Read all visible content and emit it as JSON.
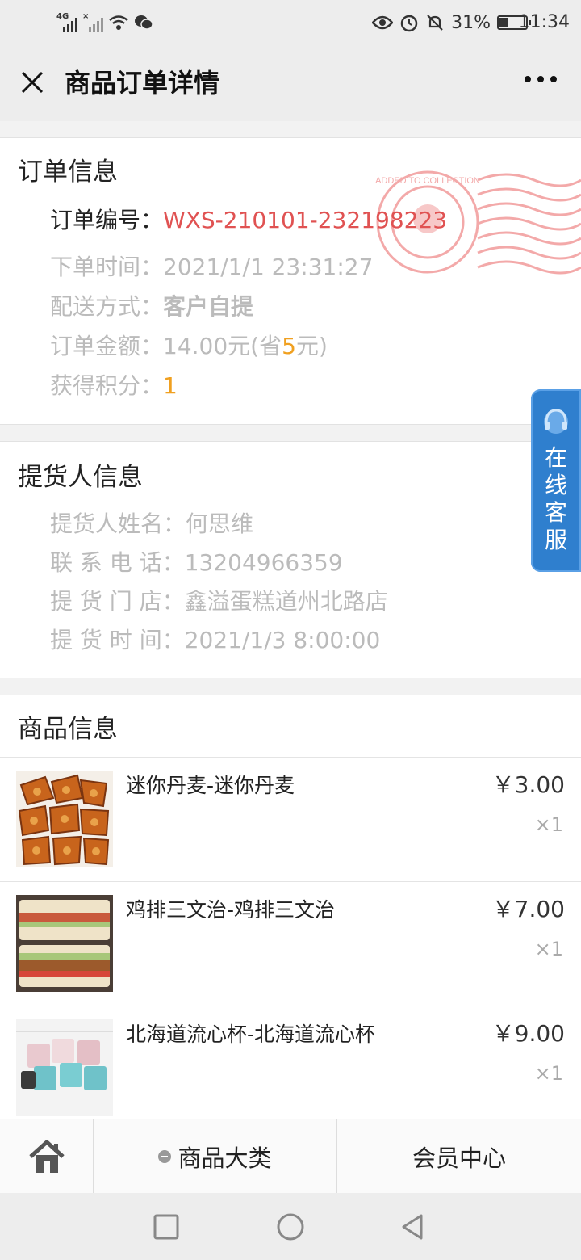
{
  "status_bar": {
    "network_label": "4G",
    "battery_percent": "31%",
    "battery_level": 0.31,
    "time": "11:34"
  },
  "header": {
    "title": "商品订单详情"
  },
  "order_info": {
    "title": "订单信息",
    "order_no_label": "订单编号：",
    "order_no": "WXS-210101-232198223",
    "order_time_label": "下单时间：",
    "order_time": "2021/1/1 23:31:27",
    "delivery_label": "配送方式：",
    "delivery": "客户自提",
    "amount_label": "订单金额：",
    "amount_prefix": "14.00元(省",
    "amount_saved": "5",
    "amount_suffix": "元)",
    "points_label": "获得积分：",
    "points": "1",
    "stamp_text": "ADDED TO COLLECTION"
  },
  "pickup_info": {
    "title": "提货人信息",
    "name_label": "提货人姓名：",
    "name": "何思维",
    "phone_label": "联 系 电 话：",
    "phone": "13204966359",
    "store_label": "提 货 门 店：",
    "store": "鑫溢蛋糕道州北路店",
    "time_label": "提 货 时 间：",
    "time": "2021/1/3 8:00:00"
  },
  "product_info": {
    "title": "商品信息",
    "items": [
      {
        "name": "迷你丹麦-迷你丹麦",
        "price": "￥3.00",
        "qty": "×1"
      },
      {
        "name": "鸡排三文治-鸡排三文治",
        "price": "￥7.00",
        "qty": "×1"
      },
      {
        "name": "北海道流心杯-北海道流心杯",
        "price": "￥9.00",
        "qty": "×1"
      }
    ]
  },
  "float_service": {
    "label_1": "在",
    "label_2": "线",
    "label_3": "客",
    "label_4": "服"
  },
  "tabbar": {
    "home_icon": "home-icon",
    "category_label": "商品大类",
    "member_label": "会员中心"
  },
  "colors": {
    "order_no": "#e05252",
    "highlight": "#f0a020",
    "service_button": "#2f7fce"
  }
}
